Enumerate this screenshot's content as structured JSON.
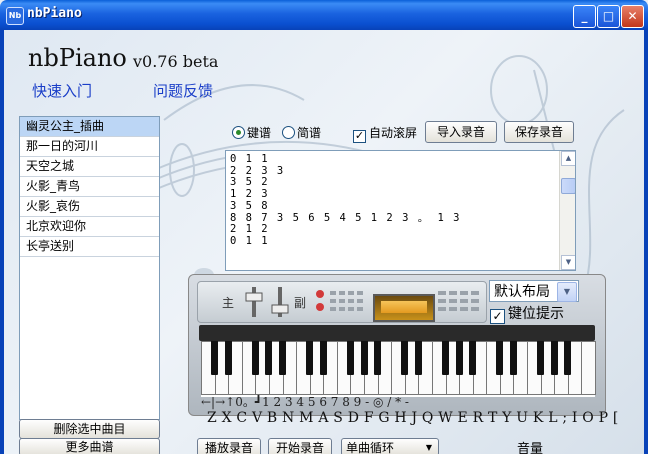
{
  "window": {
    "title": "nbPiano",
    "icon_text": "Nb",
    "minimize": "_",
    "maximize": "□",
    "close": "✕"
  },
  "header": {
    "app_name": "nbPiano",
    "version": "v0.76 beta",
    "quick_start": "快速入门",
    "feedback": "问题反馈"
  },
  "songs": [
    "幽灵公主_插曲",
    "那一日的河川",
    "天空之城",
    "火影_青鸟",
    "火影_哀伤",
    "北京欢迎你",
    "长亭送别"
  ],
  "selected_song": 0,
  "buttons": {
    "delete_selected": "删除选中曲目",
    "more_scores": "更多曲谱",
    "import_recording": "导入录音",
    "save_recording": "保存录音",
    "play_recording": "播放录音",
    "start_recording": "开始录音"
  },
  "options": {
    "mode_keyboard": "键谱",
    "mode_numbered": "简谱",
    "auto_scroll": "自动滚屏",
    "auto_scroll_checked": true,
    "selected_mode": "键谱"
  },
  "score_text": "0 1 1\n2 2 3 3\n3 5 2\n1 2 3\n3 5 8\n8 8 7 3 5 6 5 4 5 1 2 3 。 1 3\n2 1 2\n0 1 1",
  "piano": {
    "main_label": "主",
    "sub_label": "副",
    "layout_select": "默认布局",
    "key_hint": "键位提示",
    "key_hint_checked": true,
    "keymap_top": "←|→↑0。┛1 2 3 4 5 6 7 8 9 - ◎ / * -",
    "keymap_bottom": "Z X C V B N M A  S D F  G H J Q W E R T Y U K L ; I O  P ["
  },
  "loop_select": "单曲循环",
  "volume_label": "音量"
}
